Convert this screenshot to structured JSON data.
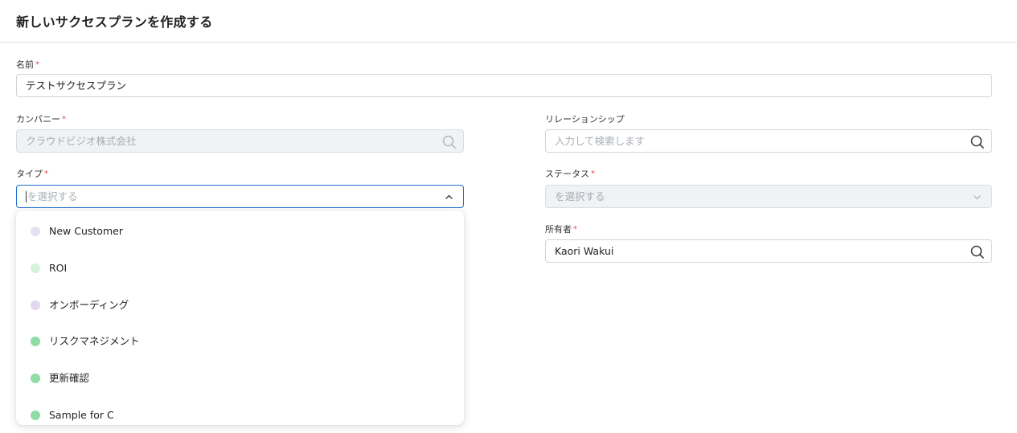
{
  "header": {
    "title": "新しいサクセスプランを作成する"
  },
  "form": {
    "name": {
      "label": "名前",
      "required_mark": "*",
      "value": "テストサクセスプラン"
    },
    "company": {
      "label": "カンパニー",
      "required_mark": "*",
      "value": "クラウドビジオ株式会社"
    },
    "relationship": {
      "label": "リレーションシップ",
      "placeholder": "入力して検索します"
    },
    "type": {
      "label": "タイプ",
      "required_mark": "*",
      "placeholder": "を選択する"
    },
    "status": {
      "label": "ステータス",
      "required_mark": "*",
      "placeholder": "を選択する"
    },
    "owner": {
      "label": "所有者",
      "required_mark": "*",
      "value": "Kaori Wakui"
    }
  },
  "type_dropdown": {
    "options": [
      {
        "label": "New Customer",
        "color": "#e4e2ef"
      },
      {
        "label": "ROI",
        "color": "#d6f2d8"
      },
      {
        "label": "オンボーディング",
        "color": "#e3d6f1"
      },
      {
        "label": "リスクマネジメント",
        "color": "#8fdca6"
      },
      {
        "label": "更新確認",
        "color": "#8fdca6"
      },
      {
        "label": "Sample for C",
        "color": "#8fdca6"
      }
    ]
  },
  "icons": {
    "search": "search-icon",
    "chevron_up": "chevron-up-icon",
    "chevron_down": "chevron-down-icon"
  }
}
